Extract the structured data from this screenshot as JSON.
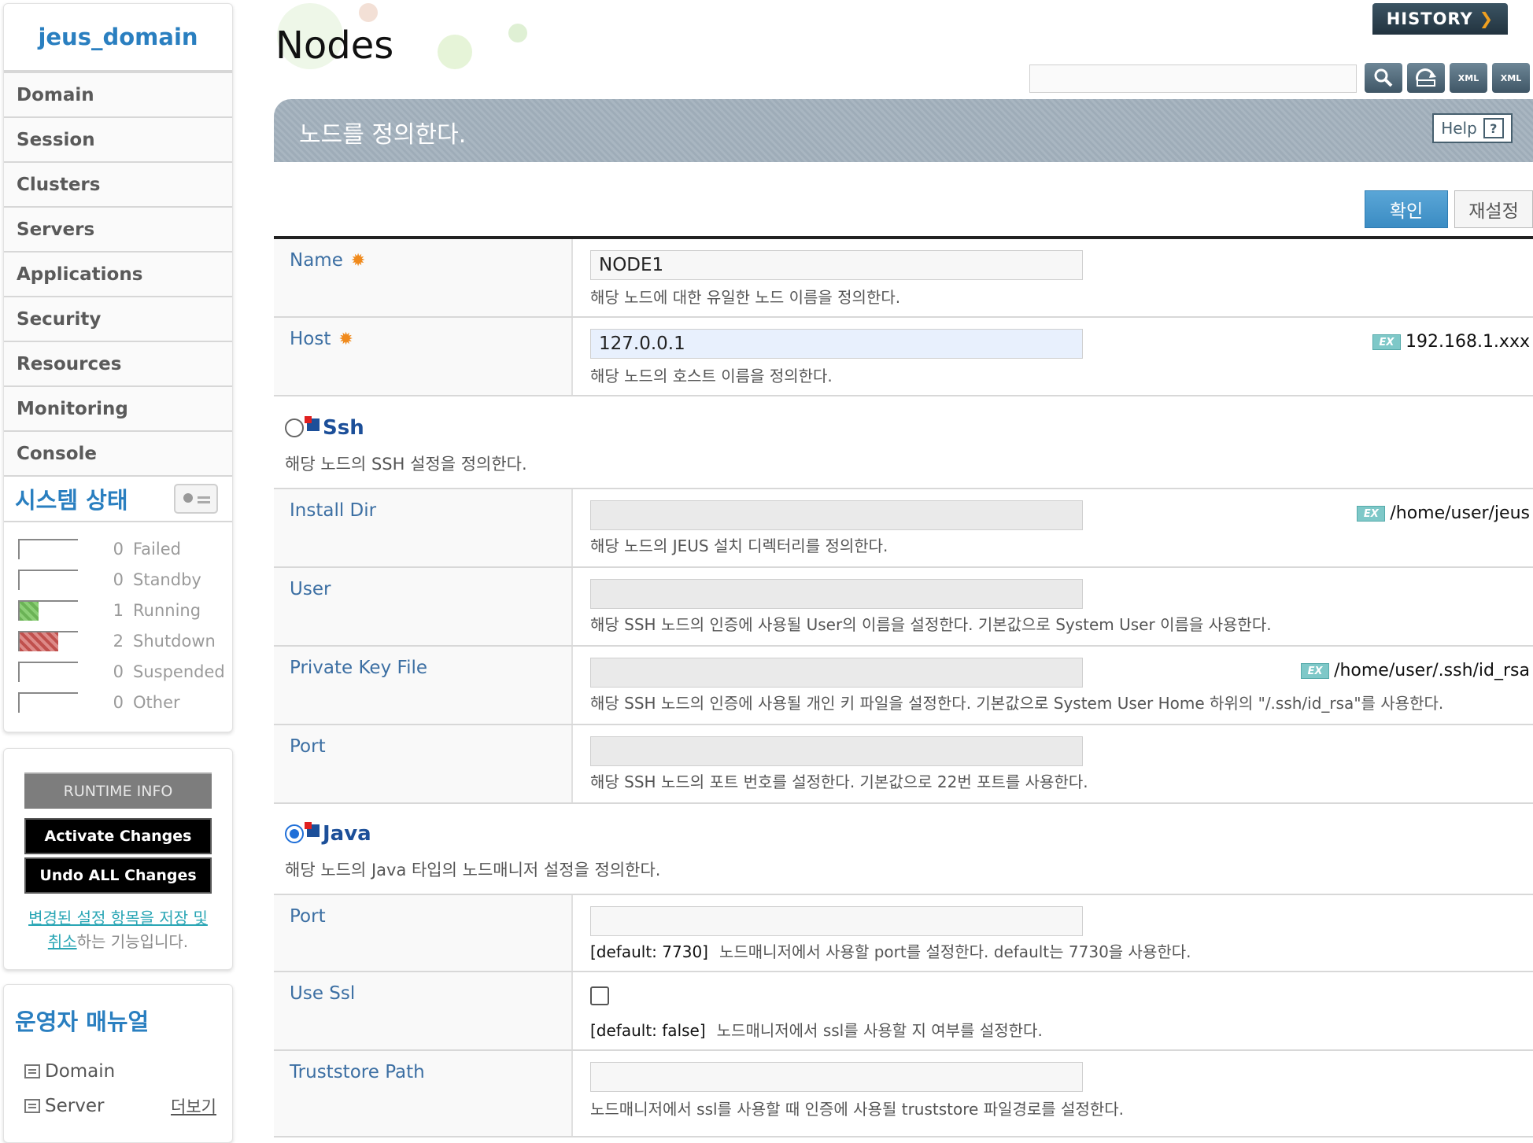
{
  "sidebar": {
    "domain": "jeus_domain",
    "menu": [
      "Domain",
      "Session",
      "Clusters",
      "Servers",
      "Applications",
      "Security",
      "Resources",
      "Monitoring",
      "Console"
    ],
    "status_title": "시스템 상태",
    "status": [
      {
        "count": "0",
        "label": "Failed",
        "fill": 0
      },
      {
        "count": "0",
        "label": "Standby",
        "fill": 0
      },
      {
        "count": "1",
        "label": "Running",
        "fill": 0.33
      },
      {
        "count": "2",
        "label": "Shutdown",
        "fill": 0.66
      },
      {
        "count": "0",
        "label": "Suspended",
        "fill": 0
      },
      {
        "count": "0",
        "label": "Other",
        "fill": 0
      }
    ],
    "runtime_info": "RUNTIME INFO",
    "activate": "Activate Changes",
    "undo": "Undo ALL Changes",
    "note_link": "변경된 설정 항목을 저장 및 취소",
    "note_rest": "하는 기능입니다.",
    "manual_title": "운영자 매뉴얼",
    "manual_items": [
      "Domain",
      "Server"
    ],
    "more": "더보기"
  },
  "header": {
    "title": "Nodes",
    "history": "HISTORY",
    "search_value": "",
    "tool_xml1": "XML",
    "tool_xml2": "XML",
    "banner": "노드를 정의한다.",
    "help": "Help",
    "confirm": "확인",
    "reset": "재설정"
  },
  "form": {
    "name": {
      "label": "Name",
      "value": "NODE1",
      "desc": "해당 노드에 대한 유일한 노드 이름을 정의한다."
    },
    "host": {
      "label": "Host",
      "value": "127.0.0.1",
      "desc": "해당 노드의 호스트 이름을 정의한다.",
      "ex": "192.168.1.xxx"
    },
    "ssh": {
      "title": "Ssh",
      "desc": "해당 노드의 SSH 설정을 정의한다.",
      "install_dir": {
        "label": "Install Dir",
        "desc": "해당 노드의 JEUS 설치 디렉터리를 정의한다.",
        "ex": "/home/user/jeus"
      },
      "user": {
        "label": "User",
        "desc": "해당 SSH 노드의 인증에 사용될 User의 이름을 설정한다. 기본값으로 System User 이름을 사용한다."
      },
      "key": {
        "label": "Private Key File",
        "desc": "해당 SSH 노드의 인증에 사용될 개인 키 파일을 설정한다. 기본값으로 System User Home 하위의 \"/.ssh/id_rsa\"를 사용한다.",
        "ex": "/home/user/.ssh/id_rsa"
      },
      "port": {
        "label": "Port",
        "desc": "해당 SSH 노드의 포트 번호를 설정한다. 기본값으로 22번 포트를 사용한다."
      }
    },
    "java": {
      "title": "Java",
      "desc": "해당 노드의 Java 타입의 노드매니저 설정을 정의한다.",
      "port": {
        "label": "Port",
        "default": "[default: 7730]",
        "desc": "노드매니저에서 사용할 port를 설정한다. default는 7730을 사용한다."
      },
      "ssl": {
        "label": "Use Ssl",
        "default": "[default: false]",
        "desc": "노드매니저에서 ssl를 사용할 지 여부를 설정한다."
      },
      "truststore": {
        "label": "Truststore Path",
        "desc": "노드매니저에서 ssl를 사용할 때 인증에 사용될 truststore 파일경로를 설정한다."
      }
    }
  },
  "ex_badge": "EX"
}
